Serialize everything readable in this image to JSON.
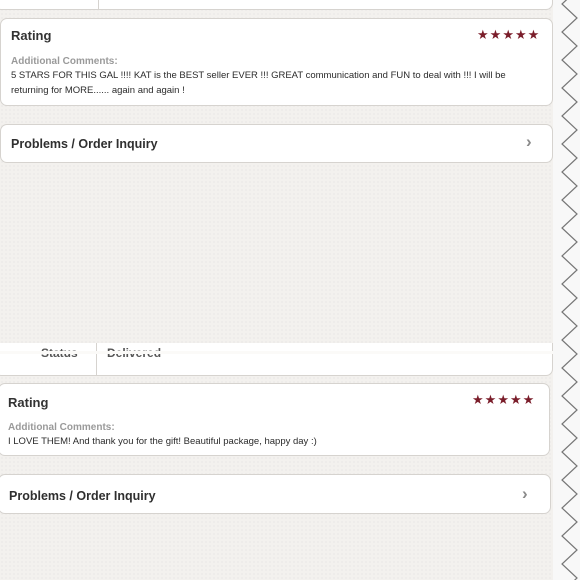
{
  "section_1": {
    "rating_title": "Rating",
    "comments_label": "Additional Comments:",
    "comments_text": "5 STARS FOR THIS GAL !!!! KAT is the BEST seller EVER !!! GREAT communication and FUN to deal with !!! I will be returning for MORE...... again and again !",
    "problems_label": "Problems / Order Inquiry",
    "rating_stars": 5
  },
  "section_2": {
    "status_label": "Status",
    "status_value": "Delivered",
    "rating_title": "Rating",
    "comments_label": "Additional Comments:",
    "comments_text": "I LOVE THEM! And thank you for the gift! Beautiful package, happy day :)",
    "problems_label": "Problems / Order Inquiry",
    "rating_stars": 5
  },
  "icons": {
    "star": "star-icon",
    "chevron": "chevron-right-icon"
  },
  "colors": {
    "star": "#7a1d2a",
    "background": "#f3f1ee",
    "card": "#ffffff"
  }
}
